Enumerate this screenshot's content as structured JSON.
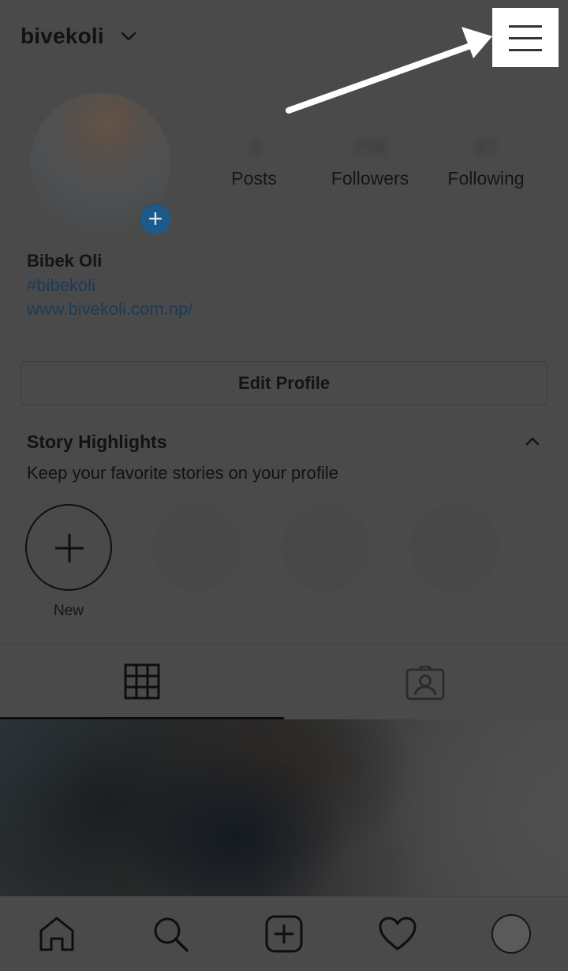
{
  "header": {
    "username": "bivekoli"
  },
  "profile": {
    "stats": [
      {
        "value": "3",
        "label": "Posts"
      },
      {
        "value": "756",
        "label": "Followers"
      },
      {
        "value": "97",
        "label": "Following"
      }
    ],
    "full_name": "Bibek Oli",
    "hashtag": "#bibekoli",
    "website": "www.bivekoli.com.np/",
    "edit_button": "Edit Profile"
  },
  "highlights": {
    "title": "Story Highlights",
    "subtitle": "Keep your favorite stories on your profile",
    "new_label": "New"
  },
  "colors": {
    "overlay_bg": "#4a4a4a",
    "link": "#1d3a58",
    "add_badge": "#1b5a8a",
    "menu_highlight": "#ffffff",
    "arrow": "#ffffff"
  },
  "icons": {
    "header": [
      "chevron-down-icon",
      "hamburger-menu-icon"
    ],
    "tabs": [
      "grid-icon",
      "tagged-icon"
    ],
    "bottom_nav": [
      "home-icon",
      "search-icon",
      "add-post-icon",
      "heart-icon",
      "profile-avatar"
    ]
  }
}
